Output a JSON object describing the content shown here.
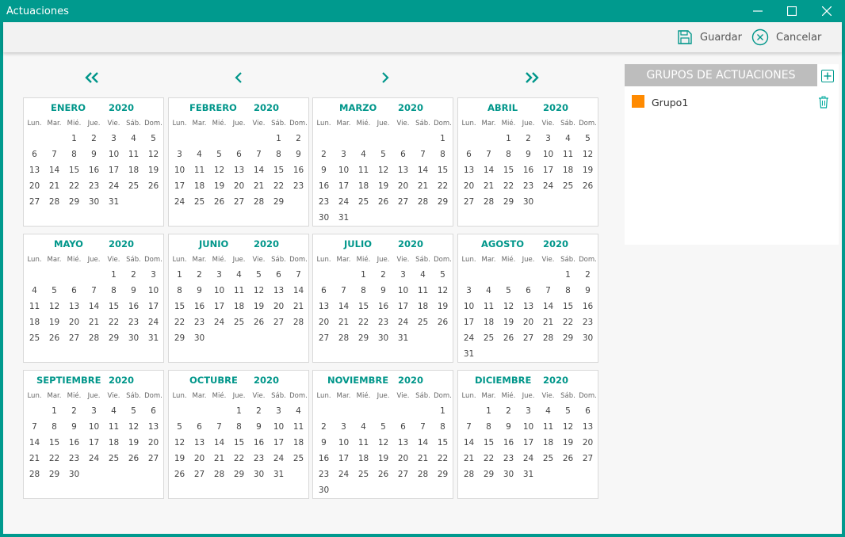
{
  "window": {
    "title": "Actuaciones",
    "controls": [
      "minimize-icon",
      "maximize-icon",
      "close-icon"
    ]
  },
  "toolbar": {
    "save_label": "Guardar",
    "cancel_label": "Cancelar"
  },
  "calendar": {
    "nav": [
      "«",
      "‹",
      "›",
      "»"
    ],
    "weekdays": [
      "Lun.",
      "Mar.",
      "Mié.",
      "Jue.",
      "Vie.",
      "Sáb.",
      "Dom."
    ],
    "year": "2020",
    "months": [
      {
        "name": "ENERO",
        "offset": 2,
        "days": 31
      },
      {
        "name": "FEBRERO",
        "offset": 5,
        "days": 29
      },
      {
        "name": "MARZO",
        "offset": 6,
        "days": 31
      },
      {
        "name": "ABRIL",
        "offset": 2,
        "days": 30
      },
      {
        "name": "MAYO",
        "offset": 4,
        "days": 31
      },
      {
        "name": "JUNIO",
        "offset": 0,
        "days": 30
      },
      {
        "name": "JULIO",
        "offset": 2,
        "days": 31
      },
      {
        "name": "AGOSTO",
        "offset": 5,
        "days": 31
      },
      {
        "name": "SEPTIEMBRE",
        "offset": 1,
        "days": 30
      },
      {
        "name": "OCTUBRE",
        "offset": 3,
        "days": 31
      },
      {
        "name": "NOVIEMBRE",
        "offset": 6,
        "days": 30
      },
      {
        "name": "DICIEMBRE",
        "offset": 1,
        "days": 31
      }
    ]
  },
  "groups_panel": {
    "title": "GRUPOS DE ACTUACIONES",
    "groups": [
      {
        "label": "Grupo1",
        "color": "#ff8a00"
      }
    ]
  },
  "colors": {
    "accent": "#009a8e",
    "month_text": "#00968a"
  }
}
